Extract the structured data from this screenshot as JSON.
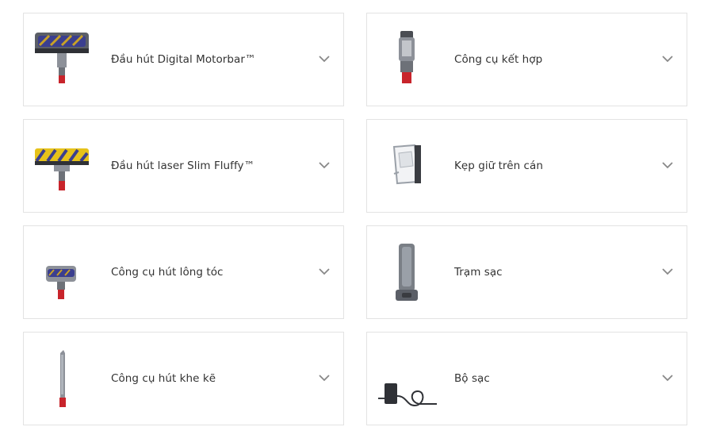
{
  "accessories": [
    {
      "label": "Đầu hút Digital Motorbar™",
      "icon": "motorbar-head-icon"
    },
    {
      "label": "Công cụ kết hợp",
      "icon": "combination-tool-icon"
    },
    {
      "label": "Đầu hút laser Slim Fluffy™",
      "icon": "laser-slim-fluffy-head-icon"
    },
    {
      "label": "Kẹp giữ trên cán",
      "icon": "wand-clip-icon"
    },
    {
      "label": "Công cụ hút lông tóc",
      "icon": "hair-screw-tool-icon"
    },
    {
      "label": "Trạm sạc",
      "icon": "docking-station-icon"
    },
    {
      "label": "Công cụ hút khe kẽ",
      "icon": "crevice-tool-icon"
    },
    {
      "label": "Bộ sạc",
      "icon": "charger-icon"
    }
  ],
  "colors": {
    "border": "#e3e3e3",
    "text": "#333333",
    "chevron": "#888888",
    "accent_red": "#c8242b",
    "brush_purple": "#3b3f8f",
    "brush_yellow": "#e6c21a",
    "metal_gray": "#7a7f86"
  }
}
